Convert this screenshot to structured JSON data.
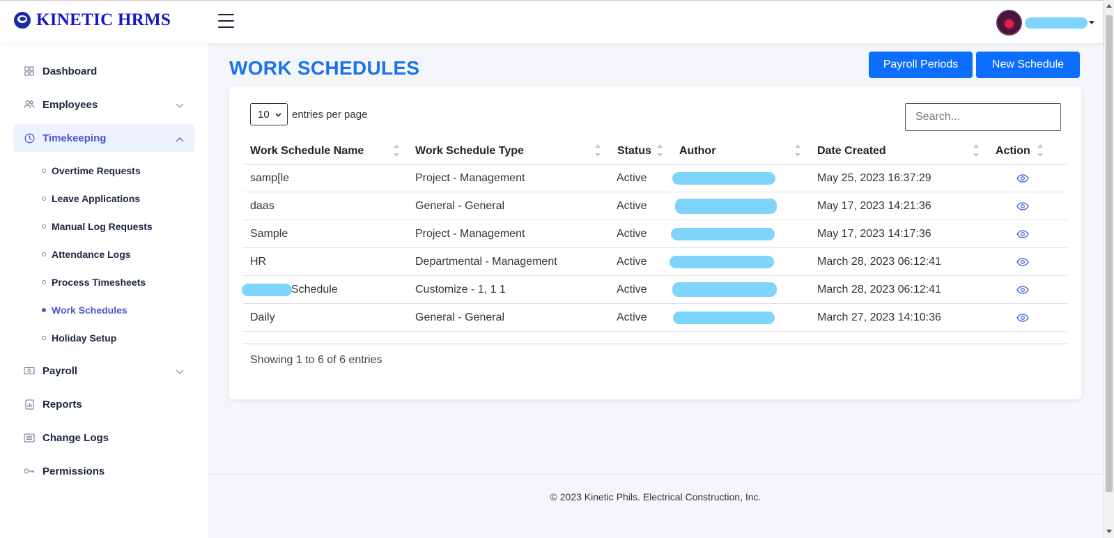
{
  "brand": {
    "name": "KINETIC HRMS"
  },
  "sidebar": {
    "items": [
      {
        "label": "Dashboard",
        "icon": "grid-icon"
      },
      {
        "label": "Employees",
        "icon": "users-icon"
      },
      {
        "label": "Timekeeping",
        "icon": "clock-icon"
      },
      {
        "label": "Payroll",
        "icon": "money-icon"
      },
      {
        "label": "Reports",
        "icon": "report-icon"
      },
      {
        "label": "Change Logs",
        "icon": "list-icon"
      },
      {
        "label": "Permissions",
        "icon": "key-icon"
      }
    ],
    "timekeeping_sub": [
      {
        "label": "Overtime Requests"
      },
      {
        "label": "Leave Applications"
      },
      {
        "label": "Manual Log Requests"
      },
      {
        "label": "Attendance Logs"
      },
      {
        "label": "Process Timesheets"
      },
      {
        "label": "Work Schedules"
      },
      {
        "label": "Holiday Setup"
      }
    ]
  },
  "page": {
    "title": "WORK SCHEDULES",
    "payroll_periods_button": "Payroll Periods",
    "new_schedule_button": "New Schedule"
  },
  "table": {
    "per_page_value": "10",
    "per_page_label": "entries per page",
    "search_placeholder": "Search...",
    "columns": [
      "Work Schedule Name",
      "Work Schedule Type",
      "Status",
      "Author",
      "Date Created",
      "Action"
    ],
    "rows": [
      {
        "name": "samp[le",
        "type": "Project - Management",
        "status": "Active",
        "date": "May 25, 2023 16:37:29"
      },
      {
        "name": "daas",
        "type": "General - General",
        "status": "Active",
        "date": "May 17, 2023 14:21:36"
      },
      {
        "name": "Sample",
        "type": "Project - Management",
        "status": "Active",
        "date": "May 17, 2023 14:17:36"
      },
      {
        "name": "HR",
        "type": "Departmental - Management",
        "status": "Active",
        "date": "March 28, 2023 06:12:41"
      },
      {
        "name": "Schedule",
        "type": "Customize - 1, 1 1",
        "status": "Active",
        "date": "March 28, 2023 06:12:41"
      },
      {
        "name": "Daily",
        "type": "General - General",
        "status": "Active",
        "date": "March 27, 2023 14:10:36"
      }
    ],
    "showing": "Showing 1 to 6 of 6 entries"
  },
  "footer": {
    "text": "© 2023 Kinetic Phils. Electrical Construction, Inc."
  },
  "colors": {
    "accent": "#0d6efd",
    "title": "#1a73e8",
    "brand": "#1717c9",
    "active_nav": "#4a58c8",
    "redaction": "#7fd4fb"
  }
}
